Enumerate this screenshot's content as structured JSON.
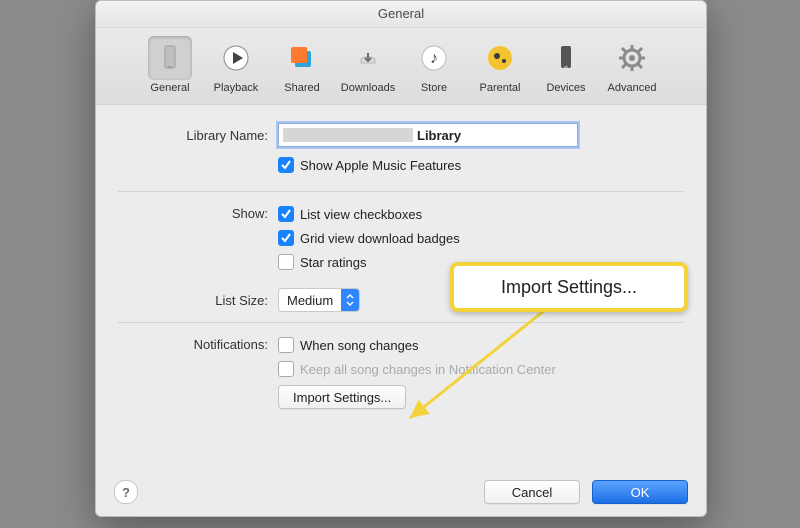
{
  "window": {
    "title": "General"
  },
  "toolbar": {
    "items": [
      {
        "label": "General"
      },
      {
        "label": "Playback"
      },
      {
        "label": "Shared"
      },
      {
        "label": "Downloads"
      },
      {
        "label": "Store"
      },
      {
        "label": "Parental"
      },
      {
        "label": "Devices"
      },
      {
        "label": "Advanced"
      }
    ]
  },
  "form": {
    "library_name_label": "Library Name:",
    "library_name_suffix": "Library",
    "show_apple_music": "Show Apple Music Features",
    "show_label": "Show:",
    "list_view_checkboxes": "List view checkboxes",
    "grid_view_badges": "Grid view download badges",
    "star_ratings": "Star ratings",
    "list_size_label": "List Size:",
    "list_size_value": "Medium",
    "notifications_label": "Notifications:",
    "when_song_changes": "When song changes",
    "keep_all_changes": "Keep all song changes in Notification Center",
    "import_settings": "Import Settings..."
  },
  "callout": {
    "text": "Import Settings..."
  },
  "footer": {
    "help": "?",
    "cancel": "Cancel",
    "ok": "OK"
  }
}
